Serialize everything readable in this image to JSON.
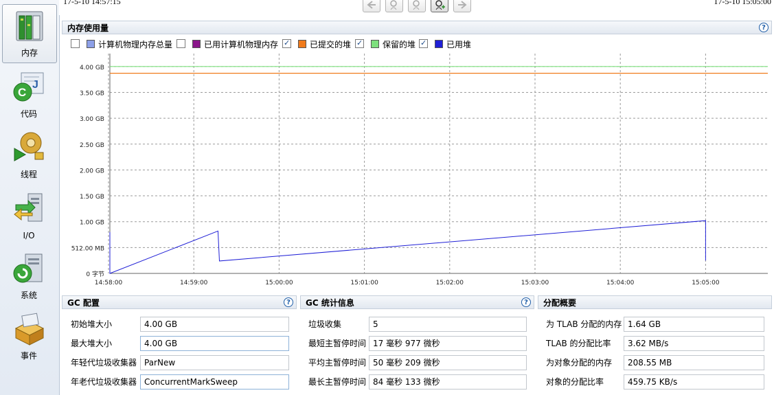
{
  "nav": [
    {
      "label": "内存",
      "icon": "memory-icon",
      "selected": true
    },
    {
      "label": "代码",
      "icon": "code-icon"
    },
    {
      "label": "线程",
      "icon": "threads-icon"
    },
    {
      "label": "I/O",
      "icon": "io-icon"
    },
    {
      "label": "系统",
      "icon": "system-icon"
    },
    {
      "label": "事件",
      "icon": "events-icon"
    }
  ],
  "timeline": {
    "start": "17-5-10 14:57:15",
    "end": "17-5-10 15:05:00"
  },
  "memory": {
    "title": "内存使用量",
    "legend": [
      {
        "label": "计算机物理内存总量",
        "color": "#8da0e8",
        "checked": false
      },
      {
        "label": "已用计算机物理内存",
        "color": "#8b168b",
        "checked": false
      },
      {
        "label": "已提交的堆",
        "color": "#f07a1b",
        "checked": true
      },
      {
        "label": "保留的堆",
        "color": "#7ee07e",
        "checked": true
      },
      {
        "label": "已用堆",
        "color": "#1f1fd6",
        "checked": true
      }
    ]
  },
  "chart_data": {
    "type": "line",
    "y_ticks": [
      "0 字节",
      "512.00 MB",
      "1.00 GB",
      "1.50 GB",
      "2.00 GB",
      "2.50 GB",
      "3.00 GB",
      "3.50 GB",
      "4.00 GB"
    ],
    "x_ticks": [
      "14:58:00",
      "14:59:00",
      "15:00:00",
      "15:01:00",
      "15:02:00",
      "15:03:00",
      "15:04:00",
      "15:05:00"
    ],
    "ylim_gb": [
      0,
      4.25
    ],
    "series": [
      {
        "name": "保留的堆",
        "color": "#7ee07e",
        "constant_gb": 4.0
      },
      {
        "name": "已提交的堆",
        "color": "#f07a1b",
        "constant_gb": 3.87
      },
      {
        "name": "已用堆",
        "color": "#1f1fd6",
        "points_gb": [
          [
            "14:57:17",
            0.27
          ],
          [
            "14:57:18",
            0.8
          ],
          [
            "14:57:19",
            0.3
          ],
          [
            "14:57:20",
            0.78
          ],
          [
            "14:57:21",
            0.0
          ],
          [
            "14:57:24",
            0.01
          ],
          [
            "14:57:27",
            0.3
          ],
          [
            "14:57:28",
            0.0
          ],
          [
            "14:59:17",
            0.82
          ],
          [
            "14:59:18",
            0.24
          ],
          [
            "15:05:00",
            1.02
          ],
          [
            "15:05:00",
            0.25
          ]
        ]
      }
    ]
  },
  "gc_config": {
    "title": "GC 配置",
    "rows": [
      {
        "label": "初始堆大小",
        "value": "4.00 GB"
      },
      {
        "label": "最大堆大小",
        "value": "4.00 GB"
      },
      {
        "label": "年轻代垃圾收集器",
        "value": "ParNew"
      },
      {
        "label": "年老代垃圾收集器",
        "value": "ConcurrentMarkSweep"
      }
    ]
  },
  "gc_stats": {
    "title": "GC 统计信息",
    "rows": [
      {
        "label": "垃圾收集",
        "value": "5"
      },
      {
        "label": "最短主暂停时间",
        "value": "17 毫秒 977 微秒"
      },
      {
        "label": "平均主暂停时间",
        "value": "50 毫秒 209 微秒"
      },
      {
        "label": "最长主暂停时间",
        "value": "84 毫秒 133 微秒"
      }
    ]
  },
  "alloc": {
    "title": "分配概要",
    "rows": [
      {
        "label": "为 TLAB 分配的内存",
        "value": "1.64 GB"
      },
      {
        "label": "TLAB 的分配比率",
        "value": "3.62 MB/s"
      },
      {
        "label": "为对象分配的内存",
        "value": "208.55 MB"
      },
      {
        "label": "对象的分配比率",
        "value": "459.75 KB/s"
      }
    ]
  }
}
